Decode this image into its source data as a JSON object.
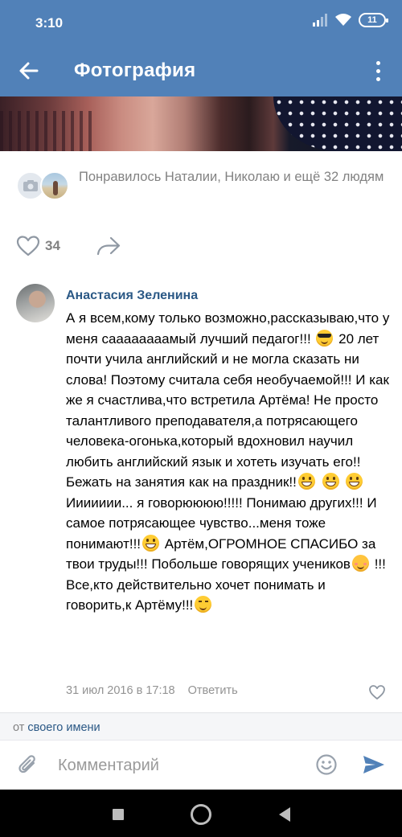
{
  "status_bar": {
    "time": "3:10",
    "battery": "11"
  },
  "header": {
    "title": "Фотография",
    "back_icon": "arrow-left-icon",
    "more_icon": "more-vertical-icon",
    "background_color": "#5181b8"
  },
  "likes_summary": {
    "text": "Понравилось Наталии, Николаю и ещё 32 людям"
  },
  "actions": {
    "like_count": "34",
    "like_icon": "heart-icon",
    "share_icon": "share-arrow-icon"
  },
  "comment": {
    "author": "Анастасия Зеленина",
    "segments": [
      {
        "type": "text",
        "value": "А я всем,кому только возможно,рассказываю,что у меня саааааааамый лучший педагог!!! "
      },
      {
        "type": "emoji",
        "value": "cool"
      },
      {
        "type": "text",
        "value": " 20 лет почти учила английский и не могла сказать ни слова! Поэтому считала себя необучаемой!!! И как же я счастлива,что встретила Артёма! Не просто талантливого преподавателя,а потрясающего человека-огонька,который вдохновил научил любить английский язык и хотеть изучать его!! Бежать на занятия как на праздник!!"
      },
      {
        "type": "emoji",
        "value": "grin"
      },
      {
        "type": "text",
        "value": " "
      },
      {
        "type": "emoji",
        "value": "grin"
      },
      {
        "type": "text",
        "value": " "
      },
      {
        "type": "emoji",
        "value": "grin"
      },
      {
        "type": "text",
        "value": " Иииииии... я говорюююю!!!!! Понимаю других!!! И самое потрясающее чувство...меня тоже понимают!!!"
      },
      {
        "type": "emoji",
        "value": "grin"
      },
      {
        "type": "text",
        "value": " Артём,ОГРОМНОЕ СПАСИБО за твои труды!!! Побольше говорящих учеников"
      },
      {
        "type": "emoji",
        "value": "blush"
      },
      {
        "type": "text",
        "value": " !!! Все,кто действительно хочет понимать и говорить,к Артёму!!!"
      },
      {
        "type": "emoji",
        "value": "wink"
      }
    ],
    "date": "31 июл 2016 в 17:18",
    "reply_label": "Ответить"
  },
  "composer": {
    "from_prefix": "от",
    "from_link": "своего имени",
    "placeholder": "Комментарий",
    "attach_icon": "paperclip-icon",
    "emoji_icon": "smiley-icon",
    "send_icon": "send-icon",
    "accent_color": "#5181b8"
  },
  "nav": {
    "icons": [
      "recents-square-icon",
      "home-circle-icon",
      "back-triangle-icon"
    ]
  }
}
